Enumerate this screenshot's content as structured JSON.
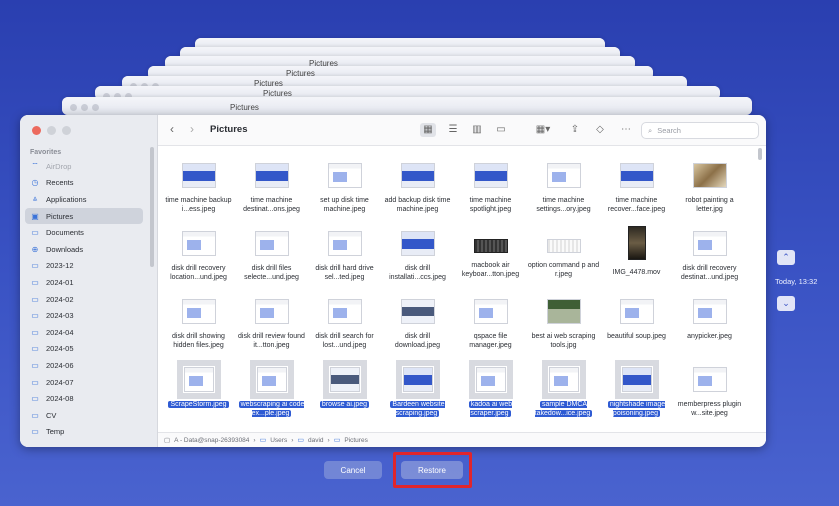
{
  "window": {
    "title": "Pictures"
  },
  "ghost_windows": {
    "title": "Pictures"
  },
  "toolbar": {
    "search_placeholder": "Search",
    "back": "‹",
    "forward": "›"
  },
  "sidebar": {
    "section": "Favorites",
    "items": [
      {
        "label": "AirDrop",
        "icon": "airdrop-icon",
        "glyph": "⌔",
        "dim": true
      },
      {
        "label": "Recents",
        "icon": "clock-icon",
        "glyph": "◷"
      },
      {
        "label": "Applications",
        "icon": "applications-icon",
        "glyph": "⩓"
      },
      {
        "label": "Pictures",
        "icon": "pictures-icon",
        "glyph": "▣",
        "active": true
      },
      {
        "label": "Documents",
        "icon": "document-icon",
        "glyph": "▭"
      },
      {
        "label": "Downloads",
        "icon": "download-icon",
        "glyph": "⊕"
      },
      {
        "label": "2023-12",
        "icon": "folder-icon",
        "glyph": "▭"
      },
      {
        "label": "2024-01",
        "icon": "folder-icon",
        "glyph": "▭"
      },
      {
        "label": "2024-02",
        "icon": "folder-icon",
        "glyph": "▭"
      },
      {
        "label": "2024-03",
        "icon": "folder-icon",
        "glyph": "▭"
      },
      {
        "label": "2024-04",
        "icon": "folder-icon",
        "glyph": "▭"
      },
      {
        "label": "2024-05",
        "icon": "folder-icon",
        "glyph": "▭"
      },
      {
        "label": "2024-06",
        "icon": "folder-icon",
        "glyph": "▭"
      },
      {
        "label": "2024-07",
        "icon": "folder-icon",
        "glyph": "▭"
      },
      {
        "label": "2024-08",
        "icon": "folder-icon",
        "glyph": "▭"
      },
      {
        "label": "CV",
        "icon": "folder-icon",
        "glyph": "▭"
      },
      {
        "label": "Temp",
        "icon": "folder-icon",
        "glyph": "▭"
      }
    ]
  },
  "files": [
    {
      "name": "time machine backup i...ess.jpeg",
      "thumb": "blue"
    },
    {
      "name": "time machine destinat...ons.jpeg",
      "thumb": "blue"
    },
    {
      "name": "set up disk time machine.jpeg",
      "thumb": "win"
    },
    {
      "name": "add backup disk time machine.jpeg",
      "thumb": "blue"
    },
    {
      "name": "time machine spotlight.jpeg",
      "thumb": "blue"
    },
    {
      "name": "time machine settings...ory.jpeg",
      "thumb": "win"
    },
    {
      "name": "time machine recover...face.jpeg",
      "thumb": "blue"
    },
    {
      "name": "robot painting a letter.jpg",
      "thumb": "paint"
    },
    {
      "name": "disk drill recovery location...und.jpeg",
      "thumb": "win"
    },
    {
      "name": "disk drill files selecte...und.jpeg",
      "thumb": "win"
    },
    {
      "name": "disk drill hard drive sel...ted.jpeg",
      "thumb": "win"
    },
    {
      "name": "disk drill installati...ccs.jpeg",
      "thumb": "blue"
    },
    {
      "name": "macbook air keyboar...tton.jpeg",
      "thumb": "kb"
    },
    {
      "name": "option command p and r.jpeg",
      "thumb": "kbw"
    },
    {
      "name": "IMG_4478.mov",
      "thumb": "photo"
    },
    {
      "name": "disk drill recovery destinat...und.jpeg",
      "thumb": "win"
    },
    {
      "name": "disk drill showing hidden files.jpeg",
      "thumb": "win"
    },
    {
      "name": "disk drill review found it...tton.jpeg",
      "thumb": "win"
    },
    {
      "name": "disk drill search for lost...und.jpeg",
      "thumb": "win"
    },
    {
      "name": "disk drill download.jpeg",
      "thumb": "dark"
    },
    {
      "name": "qspace file manager.jpeg",
      "thumb": "win"
    },
    {
      "name": "best ai web scraping tools.jpg",
      "thumb": "green"
    },
    {
      "name": "beautiful soup.jpeg",
      "thumb": "win"
    },
    {
      "name": "anypicker.jpeg",
      "thumb": "win"
    },
    {
      "name": "ScrapeStorm.jpeg",
      "thumb": "win",
      "selected": true
    },
    {
      "name": "webscraping ai code ex...ple.jpeg",
      "thumb": "win",
      "selected": true
    },
    {
      "name": "browse ai.jpeg",
      "thumb": "dark",
      "selected": true
    },
    {
      "name": "Bardeen website scraping.jpeg",
      "thumb": "blue",
      "selected": true
    },
    {
      "name": "kadoa ai web scraper.jpeg",
      "thumb": "win",
      "selected": true
    },
    {
      "name": "sample DMCA takedow...ice.jpeg",
      "thumb": "win",
      "selected": true
    },
    {
      "name": "nightshade image poisoning.jpeg",
      "thumb": "blue",
      "selected": true
    },
    {
      "name": "memberpress plugin w...site.jpeg",
      "thumb": "win"
    }
  ],
  "pathbar": {
    "segments": [
      "A - Data@snap-26393084",
      "Users",
      "david",
      "Pictures"
    ],
    "separator": "›"
  },
  "timemachine": {
    "timestamp": "Today, 13:32",
    "up": "⌃",
    "down": "⌄"
  },
  "buttons": {
    "cancel": "Cancel",
    "restore": "Restore"
  },
  "colors": {
    "accent": "#2f5bd3",
    "highlight": "#e0252c",
    "background": "#3a53c4"
  }
}
